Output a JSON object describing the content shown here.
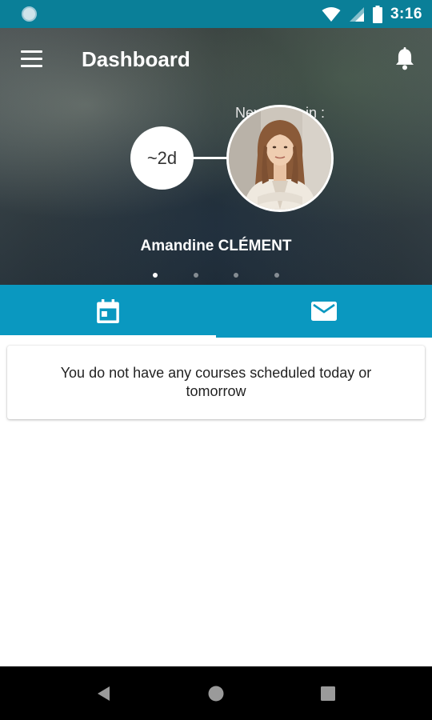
{
  "status_bar": {
    "time": "3:16",
    "icons": [
      "notification-dot-icon",
      "wifi-icon",
      "signal-icon",
      "battery-icon"
    ]
  },
  "header": {
    "title": "Dashboard",
    "next_class_label": "Next class in :",
    "countdown": "~2d",
    "teacher_name": "Amandine CLÉMENT",
    "pager": {
      "count": 4,
      "active_index": 0
    }
  },
  "tabs": [
    {
      "name": "calendar",
      "icon": "calendar-icon",
      "active": true
    },
    {
      "name": "messages",
      "icon": "mail-icon",
      "active": false
    }
  ],
  "content": {
    "empty_message": "You do not have any courses scheduled today or tomorrow"
  },
  "nav_bar": {
    "buttons": [
      "back-icon",
      "home-icon",
      "recents-icon"
    ]
  },
  "colors": {
    "status_bar": "#0a7f98",
    "tab_bar": "#0a98c0",
    "nav_bar": "#000000"
  }
}
